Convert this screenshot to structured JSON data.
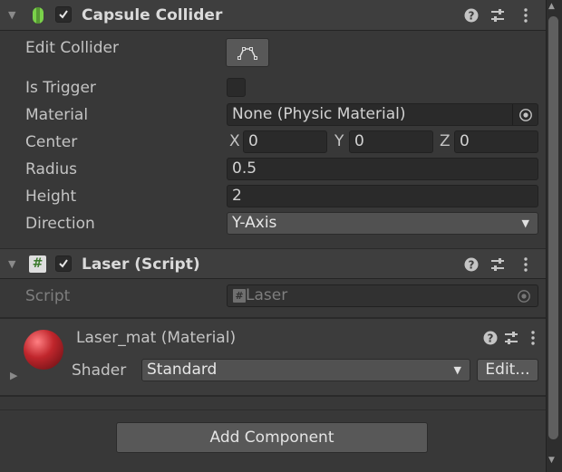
{
  "capsule_collider": {
    "title": "Capsule Collider",
    "enabled": true,
    "edit_collider_label": "Edit Collider",
    "is_trigger_label": "Is Trigger",
    "is_trigger": false,
    "material_label": "Material",
    "material_value": "None (Physic Material)",
    "center_label": "Center",
    "center": {
      "x_label": "X",
      "x": "0",
      "y_label": "Y",
      "y": "0",
      "z_label": "Z",
      "z": "0"
    },
    "radius_label": "Radius",
    "radius": "0.5",
    "height_label": "Height",
    "height": "2",
    "direction_label": "Direction",
    "direction": "Y-Axis"
  },
  "laser_script": {
    "title": "Laser (Script)",
    "enabled": true,
    "script_label": "Script",
    "script_value": "Laser"
  },
  "material": {
    "name": "Laser_mat",
    "type_suffix": "(Material)",
    "shader_label": "Shader",
    "shader_value": "Standard",
    "edit_button": "Edit...",
    "sphere_color": "#c0262c"
  },
  "add_component_label": "Add Component",
  "header_icons": {
    "help": "?",
    "presets": "presets-icon",
    "menu": "kebab-menu-icon"
  },
  "colors": {
    "bg": "#383838",
    "header": "#3e3e3e",
    "field": "#2a2a2a",
    "collider_icon": "#7ad14a"
  }
}
